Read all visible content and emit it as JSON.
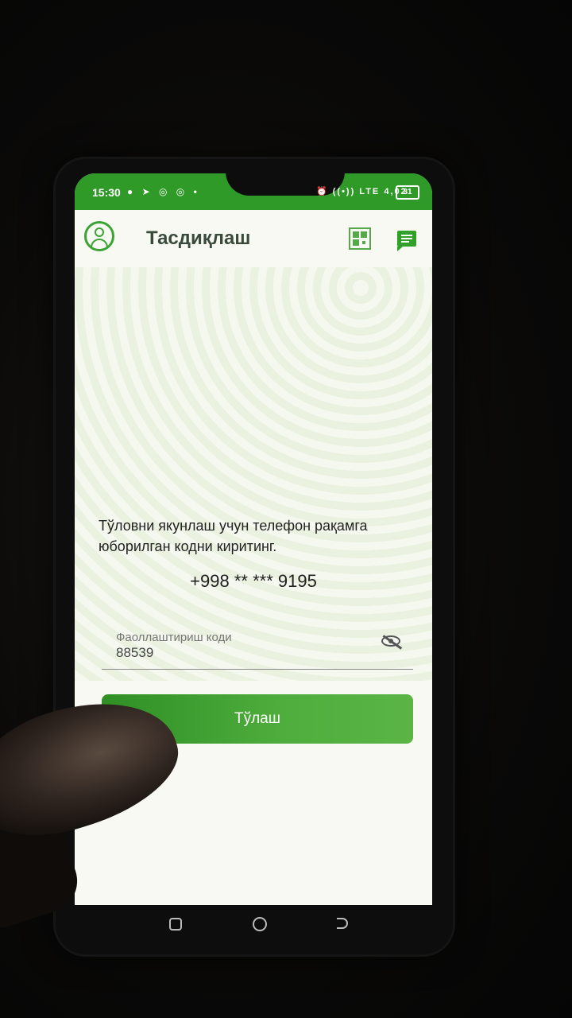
{
  "statusbar": {
    "time": "15:30",
    "left_icons": "● ➤ ◎ ◎ •",
    "right_icons": "⏰ ((•)) LTE 4,02",
    "battery": "31"
  },
  "header": {
    "title": "Тасдиқлаш",
    "profile_icon": "user-circle-icon",
    "qr_icon": "qr-code-icon",
    "chat_icon": "chat-bubble-icon"
  },
  "main": {
    "instruction": "Тўловни якунлаш учун телефон рақамга юборилган кодни киритинг.",
    "phone_number": "+998 ** *** 9195",
    "code_field": {
      "label": "Фаоллаштириш коди",
      "value": "88539",
      "toggle_icon": "eye-off-icon"
    },
    "pay_button": "Тўлаш"
  },
  "colors": {
    "accent": "#2f9a27",
    "button": "#4fae3d"
  }
}
